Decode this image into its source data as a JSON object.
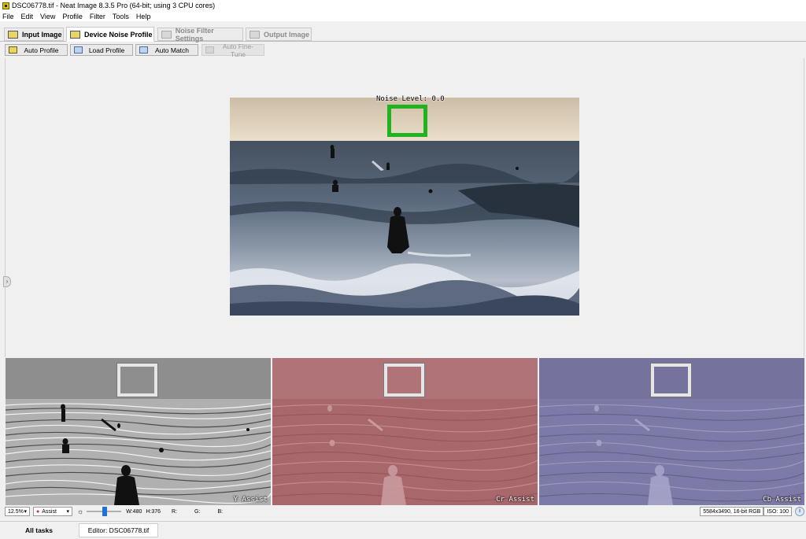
{
  "window": {
    "title": "DSC06778.tif - Neat Image 8.3.5 Pro (64-bit; using 3 CPU cores)"
  },
  "menu": [
    "File",
    "Edit",
    "View",
    "Profile",
    "Filter",
    "Tools",
    "Help"
  ],
  "tabs": [
    {
      "label": "Input Image",
      "state": "normal"
    },
    {
      "label": "Device Noise Profile",
      "state": "active"
    },
    {
      "label": "Noise Filter Settings",
      "state": "disabled"
    },
    {
      "label": "Output Image",
      "state": "disabled"
    }
  ],
  "toolbar": {
    "auto_profile": "Auto Profile",
    "load_profile": "Load Profile",
    "auto_match": "Auto Match",
    "auto_fine_tune": "Auto Fine-Tune"
  },
  "preview": {
    "noise_level": "Noise Level: 0.0"
  },
  "channels": [
    "Y Assist",
    "Cr Assist",
    "Cb Assist"
  ],
  "status": {
    "zoom": "12.5%",
    "mode": "Assist",
    "width": "W:480",
    "height": "H:376",
    "r": "R:",
    "g": "G:",
    "b": "B:",
    "format": "5584x3490, 16-bit RGB",
    "iso": "ISO: 100"
  },
  "bottom_tabs": {
    "all_tasks": "All tasks",
    "editor": "Editor: DSC06778.tif"
  },
  "colors": {
    "noise_box": "#21b21f",
    "cr_tint": "#b06a6e",
    "cb_tint": "#6e6a9a"
  }
}
